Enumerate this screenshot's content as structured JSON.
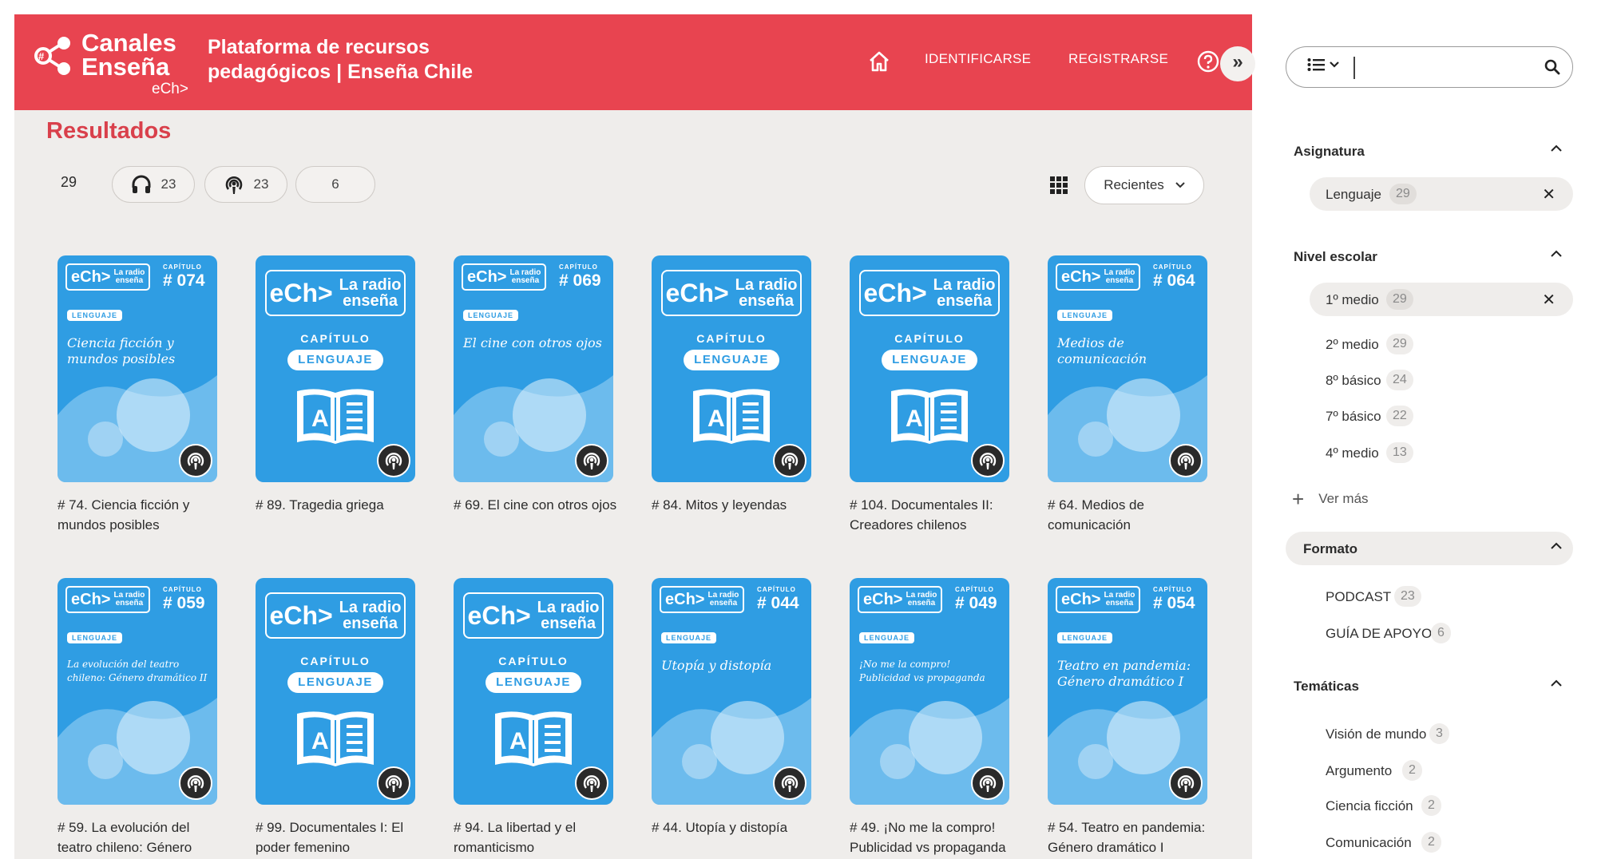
{
  "brand": {
    "line1": "Canales",
    "line2": "Enseña",
    "line3": "eCh>"
  },
  "header": {
    "platform_title": "Plataforma de recursos pedagógicos | Enseña Chile"
  },
  "nav": {
    "login": "IDENTIFICARSE",
    "register": "REGISTRARSE",
    "collapse": "»"
  },
  "results": {
    "title": "Resultados",
    "total": "29",
    "pill_audio": "23",
    "pill_podcast": "23",
    "pill_other": "6",
    "sort_label": "Recientes"
  },
  "cards": [
    {
      "title": "# 74. Ciencia ficción y mundos posibles",
      "variant": "numbered",
      "chapter": "# 074",
      "cover_title": "Ciencia ficción y mundos posibles"
    },
    {
      "title": "# 89. Tragedia griega",
      "variant": "generic"
    },
    {
      "title": "# 69. El cine con otros ojos",
      "variant": "numbered",
      "chapter": "# 069",
      "cover_title": "El cine con otros ojos"
    },
    {
      "title": "# 84. Mitos y leyendas",
      "variant": "generic"
    },
    {
      "title": "# 104. Documentales II: Creadores chilenos",
      "variant": "generic"
    },
    {
      "title": "# 64. Medios de comunicación",
      "variant": "numbered",
      "chapter": "# 064",
      "cover_title": "Medios de comunicación"
    },
    {
      "title": "# 59. La evolución del teatro chileno: Género",
      "variant": "numbered",
      "chapter": "# 059",
      "cover_title": "La evolución del teatro chileno: Género dramático II"
    },
    {
      "title": "# 99. Documentales I: El poder femenino",
      "variant": "generic"
    },
    {
      "title": "# 94. La libertad y el romanticismo",
      "variant": "generic"
    },
    {
      "title": "# 44. Utopía y distopía",
      "variant": "numbered",
      "chapter": "# 044",
      "cover_title": "Utopía y distopía"
    },
    {
      "title": "# 49. ¡No me la compro! Publicidad vs propaganda",
      "variant": "numbered",
      "chapter": "# 049",
      "cover_title": "¡No me la compro! Publicidad vs propaganda"
    },
    {
      "title": "# 54. Teatro en pandemia: Género dramático I",
      "variant": "numbered",
      "chapter": "# 054",
      "cover_title": "Teatro en pandemia: Género dramático I"
    }
  ],
  "cover": {
    "ech": "eCh>",
    "radio_line1": "La radio",
    "radio_line2": "enseña",
    "capitulo_small": "CAPÍTULO",
    "capitulo": "CAPÍTULO",
    "lenguaje": "LENGUAJE",
    "book_letter": "A"
  },
  "sidebar": {
    "search_value": "",
    "asignatura": {
      "title": "Asignatura",
      "items": [
        {
          "name": "Lenguaje",
          "count": "29"
        }
      ]
    },
    "nivel": {
      "title": "Nivel escolar",
      "items": [
        {
          "name": "1º medio",
          "count": "29"
        },
        {
          "name": "2º medio",
          "count": "29"
        },
        {
          "name": "8º básico",
          "count": "24"
        },
        {
          "name": "7º básico",
          "count": "22"
        },
        {
          "name": "4º medio",
          "count": "13"
        }
      ],
      "more": "Ver más"
    },
    "formato": {
      "title": "Formato",
      "items": [
        {
          "name": "PODCAST",
          "count": "23"
        },
        {
          "name": "GUÍA DE APOYO",
          "count": "6"
        }
      ]
    },
    "tematicas": {
      "title": "Temáticas",
      "items": [
        {
          "name": "Visión de mundo",
          "count": "3"
        },
        {
          "name": "Argumento",
          "count": "2"
        },
        {
          "name": "Ciencia ficción",
          "count": "2"
        },
        {
          "name": "Comunicación",
          "count": "2"
        }
      ]
    }
  },
  "colors": {
    "brand_red": "#e84450",
    "title_red": "#d9404b",
    "cover_blue": "#2f9de3",
    "page_bg": "#efedeb"
  },
  "icons": [
    "home-icon",
    "help-icon",
    "headphones-icon",
    "podcast-icon",
    "grid-view-icon",
    "chevron-down-icon",
    "search-icon",
    "menu-list-icon",
    "chevron-up-icon",
    "close-icon",
    "plus-icon",
    "book-icon"
  ]
}
